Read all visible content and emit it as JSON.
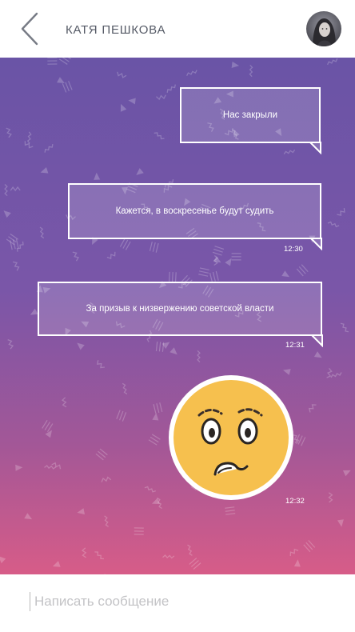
{
  "header": {
    "contact_name": "КАТЯ ПЕШКОВА",
    "back_icon": "chevron-left-icon",
    "avatar": "contact-avatar-photo"
  },
  "messages": [
    {
      "text": "Нас закрыли",
      "time": ""
    },
    {
      "text": "Кажется, в воскресенье будут судить",
      "time": "12:30"
    },
    {
      "text": "За призыв к низвержению советской власти",
      "time": "12:31"
    }
  ],
  "sticker": {
    "icon": "worried-face-emoji",
    "time": "12:32"
  },
  "composer": {
    "placeholder": "Написать сообщение"
  },
  "colors": {
    "gradient_top": "#6a54a6",
    "gradient_bottom": "#d75c88",
    "emoji_face": "#f6c04e",
    "header_text": "#555a66"
  }
}
